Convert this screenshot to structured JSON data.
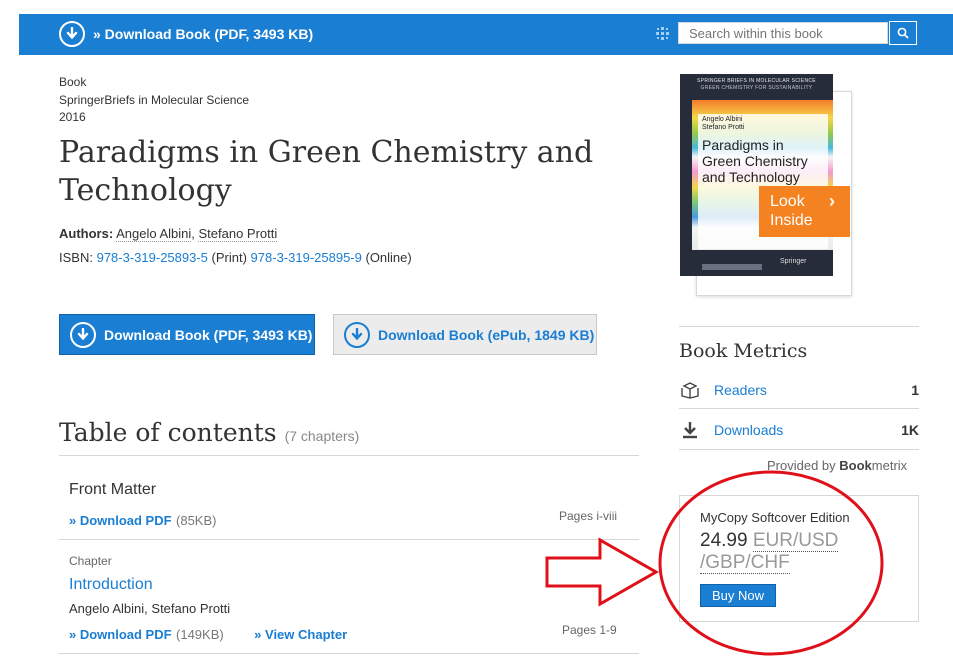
{
  "topbar": {
    "download_label": "» Download Book (PDF, 3493 KB)",
    "search_placeholder": "Search within this book"
  },
  "book": {
    "type": "Book",
    "series": "SpringerBriefs in Molecular Science",
    "year": "2016",
    "title": "Paradigms in Green Chemistry and Technology",
    "authors_label": "Authors:",
    "authors": [
      "Angelo Albini",
      "Stefano Protti"
    ],
    "isbn_label": "ISBN:",
    "isbn_print": "978-3-319-25893-5",
    "isbn_print_suffix": "(Print)",
    "isbn_online": "978-3-319-25895-9",
    "isbn_online_suffix": "(Online)"
  },
  "downloads": {
    "pdf_label": "Download Book (PDF, 3493 KB)",
    "epub_label": "Download Book (ePub, 1849 KB)"
  },
  "toc": {
    "heading": "Table of contents",
    "count": "(7 chapters)",
    "items": [
      {
        "title": "Front Matter",
        "pdf_link": "» Download PDF",
        "size": "(85KB)",
        "pages": "Pages i-viii"
      },
      {
        "label": "Chapter",
        "title": "Introduction",
        "authors": "Angelo Albini, Stefano Protti",
        "pdf_link": "» Download PDF",
        "size": "(149KB)",
        "view_link": "» View Chapter",
        "pages": "Pages 1-9"
      }
    ]
  },
  "cover": {
    "series_line1": "SPRINGER BRIEFS IN MOLECULAR SCIENCE",
    "series_line2": "GREEN CHEMISTRY FOR SUSTAINABILITY",
    "author1": "Angelo Albini",
    "author2": "Stefano Protti",
    "title": "Paradigms in Green Chemistry and Technology",
    "publisher": "Springer",
    "look_inside": "Look Inside"
  },
  "metrics": {
    "heading": "Book Metrics",
    "rows": [
      {
        "label": "Readers",
        "value": "1",
        "icon": "readers-icon"
      },
      {
        "label": "Downloads",
        "value": "1K",
        "icon": "download-arrow-icon"
      }
    ],
    "provided_by": "Provided by",
    "provider_bold": "Book",
    "provider_rest": "metrix"
  },
  "mycopy": {
    "title": "MyCopy Softcover Edition",
    "price": "24.99",
    "currencies": "EUR/USD /GBP/CHF",
    "buy_label": "Buy Now"
  },
  "colors": {
    "brand_blue": "#1a7ed3",
    "look_inside_orange": "#f58220",
    "annotation_red": "#e0101a"
  }
}
